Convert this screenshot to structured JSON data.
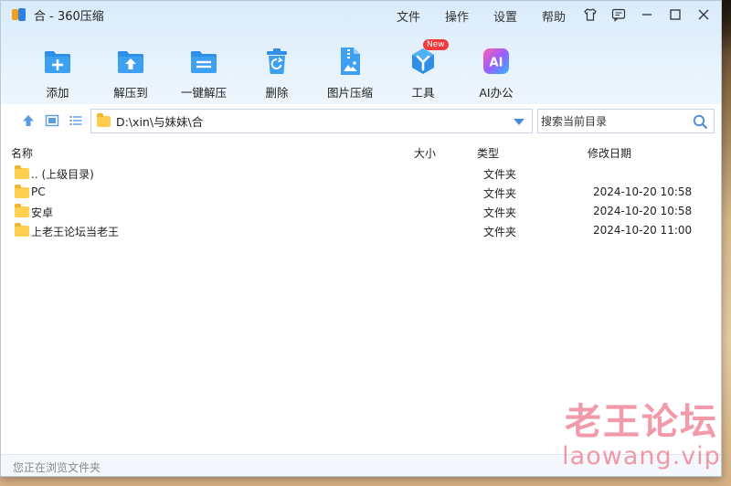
{
  "window": {
    "title": "合 - 360压缩"
  },
  "menu": [
    "文件",
    "操作",
    "设置",
    "帮助"
  ],
  "toolbar": {
    "add": "添加",
    "extract_to": "解压到",
    "one_click_extract": "一键解压",
    "delete": "删除",
    "image_compress": "图片压缩",
    "tools": "工具",
    "tools_badge": "New",
    "ai_office": "AI办公",
    "ai_glyph": "AI"
  },
  "address": {
    "path": "D:\\xin\\与妹妹\\合"
  },
  "search": {
    "placeholder": "搜索当前目录"
  },
  "columns": {
    "name": "名称",
    "size": "大小",
    "type": "类型",
    "modified": "修改日期"
  },
  "files": [
    {
      "name": ".. (上级目录)",
      "type": "文件夹",
      "modified": ""
    },
    {
      "name": "PC",
      "type": "文件夹",
      "modified": "2024-10-20 10:58"
    },
    {
      "name": "安卓",
      "type": "文件夹",
      "modified": "2024-10-20 10:58"
    },
    {
      "name": "上老王论坛当老王",
      "type": "文件夹",
      "modified": "2024-10-20 11:00"
    }
  ],
  "status": {
    "text": "您正在浏览文件夹"
  },
  "watermark": {
    "line1": "老王论坛",
    "line2": "laowang.vip"
  },
  "colors": {
    "accent": "#2f8ee8",
    "folder": "#ffcc4d",
    "badge": "#f23a3a",
    "watermark": "#ee788c"
  },
  "icons": [
    "app-logo-icon",
    "skin-icon",
    "feedback-icon",
    "minimize-icon",
    "maximize-icon",
    "close-icon",
    "add-icon",
    "extract-icon",
    "one-click-extract-icon",
    "trash-icon",
    "image-zip-icon",
    "tools-icon",
    "ai-icon",
    "up-arrow-icon",
    "view-thumbnail-icon",
    "view-list-icon",
    "folder-icon",
    "search-icon",
    "chevron-down-icon"
  ]
}
